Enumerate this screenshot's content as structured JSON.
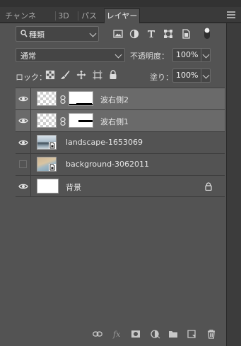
{
  "tabs": [
    {
      "label": "チャンネル",
      "active": false
    },
    {
      "label": "3D",
      "active": false
    },
    {
      "label": "パス",
      "active": false
    },
    {
      "label": "レイヤー",
      "active": true
    }
  ],
  "filter": {
    "kind_label": "種類",
    "icons": [
      "pixel-filter-icon",
      "adjustment-filter-icon",
      "type-filter-icon",
      "shape-filter-icon",
      "smart-object-filter-icon",
      "filter-toggle-icon"
    ]
  },
  "blend_mode": "通常",
  "opacity": {
    "label": "不透明度：",
    "value": "100%"
  },
  "lock": {
    "label": "ロック：",
    "icons": [
      "lock-transparent-pixels-icon",
      "lock-image-pixels-icon",
      "lock-position-icon",
      "lock-artboard-icon",
      "lock-all-icon"
    ]
  },
  "fill": {
    "label": "塗り：",
    "value": "100%"
  },
  "layers": [
    {
      "name": "波右側2",
      "visible": true,
      "selected": true,
      "type": "masked",
      "mask": "white-black-bottom"
    },
    {
      "name": "波右側1",
      "visible": true,
      "selected": true,
      "type": "masked",
      "mask": "black-lower"
    },
    {
      "name": "landscape-1653069",
      "visible": true,
      "selected": false,
      "type": "smart"
    },
    {
      "name": "background-3062011",
      "visible": false,
      "selected": false,
      "type": "smart"
    },
    {
      "name": "背景",
      "visible": true,
      "selected": false,
      "type": "background",
      "locked": true
    }
  ],
  "bottom_icons": [
    "link-layers-icon",
    "fx-icon",
    "add-mask-icon",
    "adjustment-layer-icon",
    "new-group-icon",
    "new-layer-icon",
    "delete-layer-icon"
  ],
  "colors": {
    "panel": "#535353",
    "selected_row": "#6a6a6a",
    "accent": "#ffffff"
  }
}
